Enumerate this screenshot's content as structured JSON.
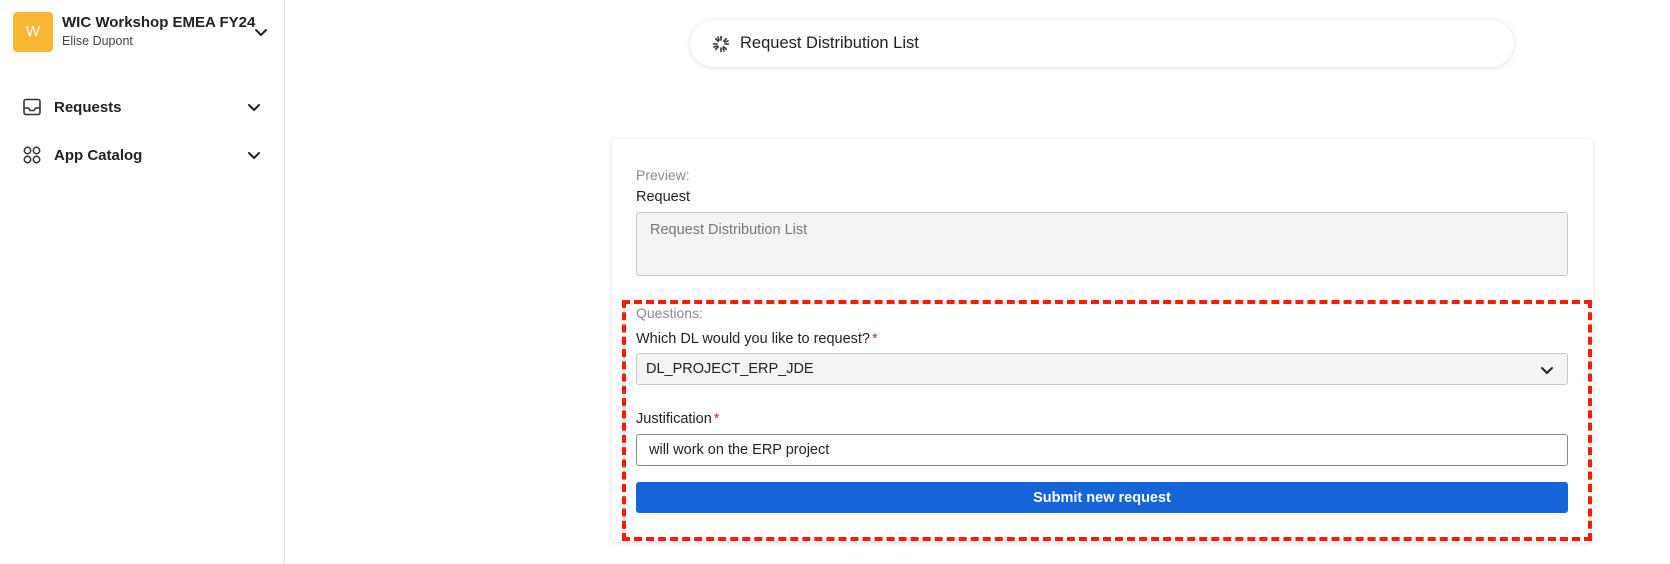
{
  "colors": {
    "accent": "#1565d8",
    "workspace_avatar": "#f7b733",
    "required_star": "#d32f2f",
    "highlight": "#ff1a00"
  },
  "sidebar": {
    "workspace": {
      "avatar_letter": "W",
      "name": "WIC Workshop EMEA FY24",
      "user": "Elise Dupont",
      "icon": "chevron-down-icon"
    },
    "items": [
      {
        "label": "Requests",
        "icon": "inbox-icon"
      },
      {
        "label": "App Catalog",
        "icon": "apps-grid-icon"
      }
    ]
  },
  "header": {
    "title": "Request Distribution List",
    "icon": "spinner-icon"
  },
  "form": {
    "preview_label": "Preview:",
    "request_label": "Request",
    "request_value": "Request Distribution List",
    "questions_label": "Questions:",
    "q1": {
      "label": "Which DL would you like to request?",
      "required_mark": "*",
      "selected": "DL_PROJECT_ERP_JDE"
    },
    "q2": {
      "label": "Justification",
      "required_mark": "*",
      "value": "will work on the ERP project"
    },
    "submit_label": "Submit new request"
  }
}
